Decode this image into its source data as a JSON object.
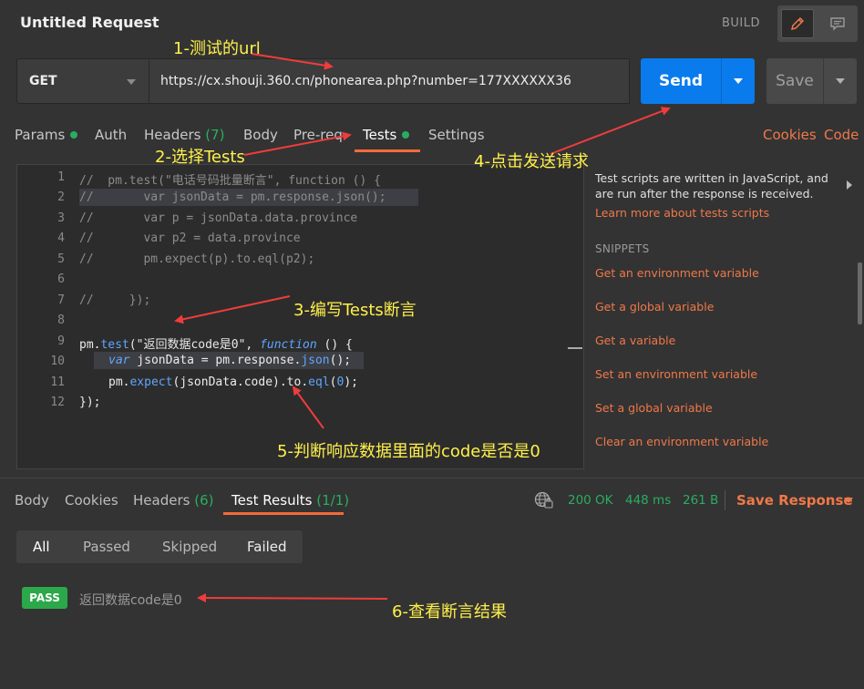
{
  "window": {
    "title": "Untitled Request",
    "build_label": "BUILD"
  },
  "request": {
    "method": "GET",
    "url": "https://cx.shouji.360.cn/phonearea.php?number=177XXXXXX36",
    "send_label": "Send",
    "save_label": "Save"
  },
  "tabs": {
    "params": "Params",
    "auth": "Auth",
    "headers": "Headers",
    "headers_count": "(7)",
    "body": "Body",
    "prereq": "Pre-req.",
    "tests": "Tests",
    "settings": "Settings",
    "cookies": "Cookies",
    "code": "Code"
  },
  "editor": {
    "line_numbers": [
      "1",
      "2",
      "3",
      "4",
      "5",
      "6",
      "7",
      "8",
      "9",
      "10",
      "11",
      "12"
    ],
    "l1": "//  pm.test(\"电话号码批量断言\", function () {",
    "l2": "//       var jsonData = pm.response.json();",
    "l3": "//       var p = jsonData.data.province",
    "l4": "//       var p2 = data.province",
    "l5": "//       pm.expect(p).to.eql(p2);",
    "l7": "//     });",
    "l9": {
      "a": "pm.",
      "b": "test",
      "c": "(\"返回数据code是0\", ",
      "d": "function",
      "e": " () {"
    },
    "l10": {
      "a": "var",
      "b": " jsonData = pm.response.",
      "c": "json",
      "d": "();"
    },
    "l11": {
      "a": "pm.",
      "b": "expect",
      "c": "(jsonData.code).to.",
      "d": "eql",
      "e": "(",
      "f": "0",
      "g": ");"
    },
    "l12": "});"
  },
  "snippets_panel": {
    "description": "Test scripts are written in JavaScript, and are run after the response is received.",
    "learn_more": "Learn more about tests scripts",
    "heading": "SNIPPETS",
    "items": [
      "Get an environment variable",
      "Get a global variable",
      "Get a variable",
      "Set an environment variable",
      "Set a global variable",
      "Clear an environment variable"
    ]
  },
  "response": {
    "tabs": {
      "body": "Body",
      "cookies": "Cookies",
      "headers": "Headers",
      "headers_count": "(6)",
      "test_results": "Test Results",
      "test_results_count": "(1/1)"
    },
    "status": "200 OK",
    "time": "448 ms",
    "size": "261 B",
    "save_response": "Save Response",
    "filters": [
      "All",
      "Passed",
      "Skipped",
      "Failed"
    ],
    "result": {
      "badge": "PASS",
      "name": "返回数据code是0"
    }
  },
  "annotations": {
    "a1": "1-测试的url",
    "a2": "2-选择Tests",
    "a3": "3-编写Tests断言",
    "a4": "4-点击发送请求",
    "a5": "5-判断响应数据里面的code是否是0",
    "a6": "6-查看断言结果",
    "color": "#fff14a"
  },
  "colors": {
    "accent_orange": "#f07848",
    "send_blue": "#097bed",
    "success_green": "#27ae60",
    "background": "#333333"
  },
  "icons": [
    "pencil-icon",
    "comment-icon",
    "chevron-down-icon",
    "globe-icon",
    "chevron-right-icon"
  ]
}
